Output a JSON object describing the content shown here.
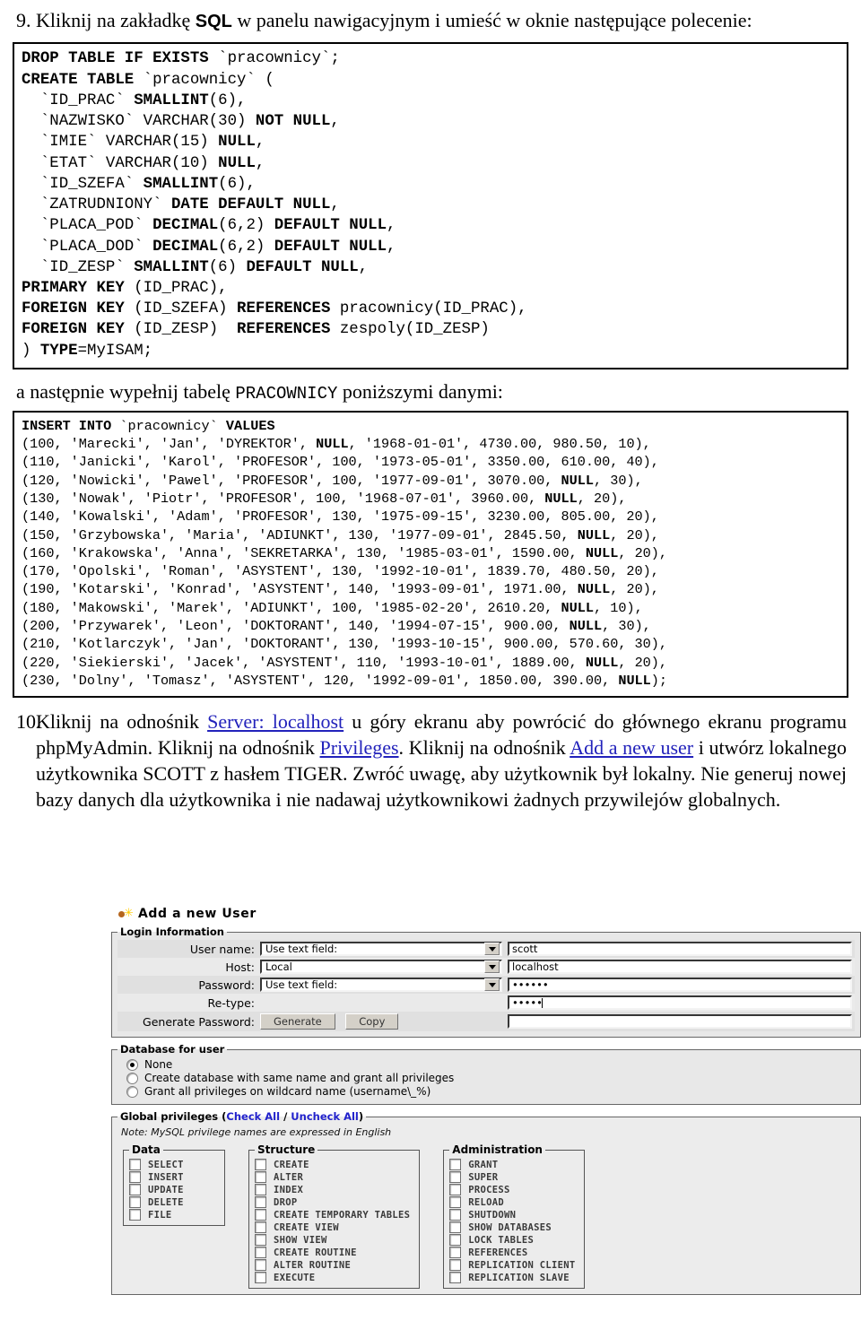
{
  "step9": {
    "number": "9.",
    "text_before": "Kliknij na zakładkę ",
    "sql_tab": "SQL",
    "text_after": " w panelu nawigacyjnym i umieść w oknie następujące polecenie:"
  },
  "sql_create": "DROP TABLE IF EXISTS `pracownicy`;\nCREATE TABLE `pracownicy` (\n  `ID_PRAC` SMALLINT(6),\n  `NAZWISKO` VARCHAR(30) NOT NULL,\n  `IMIE` VARCHAR(15) NULL,\n  `ETAT` VARCHAR(10) NULL,\n  `ID_SZEFA` SMALLINT(6),\n  `ZATRUDNIONY` DATE DEFAULT NULL,\n  `PLACA_POD` DECIMAL(6,2) DEFAULT NULL,\n  `PLACA_DOD` DECIMAL(6,2) DEFAULT NULL,\n  `ID_ZESP` SMALLINT(6) DEFAULT NULL,\nPRIMARY KEY (ID_PRAC),\nFOREIGN KEY (ID_SZEFA) REFERENCES pracownicy(ID_PRAC),\nFOREIGN KEY (ID_ZESP)  REFERENCES zespoly(ID_ZESP)\n) TYPE=MyISAM;",
  "between_text": "a następnie wypełnij tabelę PRACOWNICY poniższymi danymi:",
  "between_text_plain_1": "a następnie wypełnij tabelę ",
  "between_text_mono": "PRACOWNICY",
  "between_text_plain_2": " poniższymi danymi:",
  "sql_insert": "INSERT INTO `pracownicy` VALUES\n(100, 'Marecki', 'Jan', 'DYREKTOR', NULL, '1968-01-01', 4730.00, 980.50, 10),\n(110, 'Janicki', 'Karol', 'PROFESOR', 100, '1973-05-01', 3350.00, 610.00, 40),\n(120, 'Nowicki', 'Pawel', 'PROFESOR', 100, '1977-09-01', 3070.00, NULL, 30),\n(130, 'Nowak', 'Piotr', 'PROFESOR', 100, '1968-07-01', 3960.00, NULL, 20),\n(140, 'Kowalski', 'Adam', 'PROFESOR', 130, '1975-09-15', 3230.00, 805.00, 20),\n(150, 'Grzybowska', 'Maria', 'ADIUNKT', 130, '1977-09-01', 2845.50, NULL, 20),\n(160, 'Krakowska', 'Anna', 'SEKRETARKA', 130, '1985-03-01', 1590.00, NULL, 20),\n(170, 'Opolski', 'Roman', 'ASYSTENT', 130, '1992-10-01', 1839.70, 480.50, 20),\n(190, 'Kotarski', 'Konrad', 'ASYSTENT', 140, '1993-09-01', 1971.00, NULL, 20),\n(180, 'Makowski', 'Marek', 'ADIUNKT', 100, '1985-02-20', 2610.20, NULL, 10),\n(200, 'Przywarek', 'Leon', 'DOKTORANT', 140, '1994-07-15', 900.00, NULL, 30),\n(210, 'Kotlarczyk', 'Jan', 'DOKTORANT', 130, '1993-10-15', 900.00, 570.60, 30),\n(220, 'Siekierski', 'Jacek', 'ASYSTENT', 110, '1993-10-01', 1889.00, NULL, 20),\n(230, 'Dolny', 'Tomasz', 'ASYSTENT', 120, '1992-09-01', 1850.00, 390.00, NULL);",
  "step10": {
    "number": "10.",
    "seg1": "Kliknij na odnośnik ",
    "link1": "Server: localhost",
    "seg2": " u góry ekranu aby powrócić do głównego ekranu programu phpMyAdmin. Kliknij na odnośnik ",
    "link2": "Privileges",
    "seg3": ". Kliknij na odnośnik ",
    "link3": "Add a new user",
    "seg4": " i utwórz lokalnego użytkownika SCOTT z hasłem TIGER. Zwróć uwagę, aby użytkownik był lokalny. Nie generuj nowej bazy danych dla użytkownika i nie nadawaj użytkownikowi żadnych przywilejów globalnych."
  },
  "pma": {
    "title": "Add a new User",
    "login_legend": "Login Information",
    "rows": [
      {
        "label": "User name:",
        "select": "Use text field:",
        "value": "scott"
      },
      {
        "label": "Host:",
        "select": "Local",
        "value": "localhost"
      },
      {
        "label": "Password:",
        "select": "Use text field:",
        "value": "••••••"
      },
      {
        "label": "Re-type:",
        "select": null,
        "value": "•••••"
      }
    ],
    "generate_label": "Generate Password:",
    "generate_button": "Generate",
    "copy_button": "Copy",
    "generate_value": "",
    "db_legend": "Database for user",
    "db_options": [
      {
        "label": "None",
        "selected": true
      },
      {
        "label": "Create database with same name and grant all privileges",
        "selected": false
      },
      {
        "label": "Grant all privileges on wildcard name (username\\_%)",
        "selected": false
      }
    ],
    "global_legend_text": "Global privileges (",
    "global_check_all": "Check All",
    "global_sep": " / ",
    "global_uncheck_all": "Uncheck All",
    "global_legend_end": ")",
    "note": "Note: MySQL privilege names are expressed in English",
    "priv_groups": [
      {
        "title": "Data",
        "items": [
          "SELECT",
          "INSERT",
          "UPDATE",
          "DELETE",
          "FILE"
        ]
      },
      {
        "title": "Structure",
        "items": [
          "CREATE",
          "ALTER",
          "INDEX",
          "DROP",
          "CREATE TEMPORARY TABLES",
          "CREATE VIEW",
          "SHOW VIEW",
          "CREATE ROUTINE",
          "ALTER ROUTINE",
          "EXECUTE"
        ]
      },
      {
        "title": "Administration",
        "items": [
          "GRANT",
          "SUPER",
          "PROCESS",
          "RELOAD",
          "SHUTDOWN",
          "SHOW DATABASES",
          "LOCK TABLES",
          "REFERENCES",
          "REPLICATION CLIENT",
          "REPLICATION SLAVE"
        ]
      }
    ]
  },
  "colors": {
    "link": "#2222bb",
    "pma_panel": "#e8e8e8",
    "pma_legend_link": "#2222cc"
  }
}
